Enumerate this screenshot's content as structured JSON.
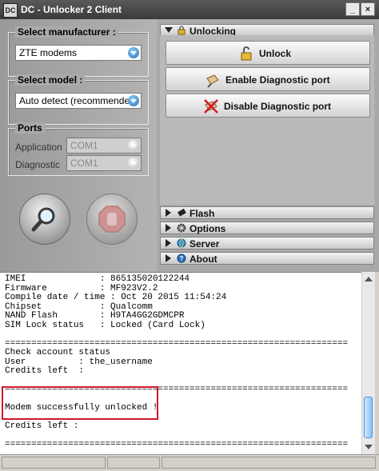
{
  "window": {
    "title": "DC - Unlocker 2 Client",
    "icon_text": "DC",
    "minimize": "_",
    "close": "×"
  },
  "manufacturer": {
    "label": "Select manufacturer :",
    "value": "ZTE modems"
  },
  "model": {
    "label": "Select model :",
    "value": "Auto detect (recommended)"
  },
  "ports": {
    "label": "Ports",
    "application_label": "Application",
    "application_value": "COM1",
    "diagnostic_label": "Diagnostic",
    "diagnostic_value": "COM1"
  },
  "sections": {
    "unlocking": "Unlocking",
    "flash": "Flash",
    "options": "Options",
    "server": "Server",
    "about": "About"
  },
  "buttons": {
    "unlock": "Unlock",
    "enable_diag": "Enable Diagnostic port",
    "disable_diag": "Disable Diagnostic port"
  },
  "icons": {
    "search": "magnifier-icon",
    "stop": "stop-hand-icon",
    "lock": "padlock-icon",
    "enable": "plug-icon",
    "disable": "crossed-plug-icon"
  },
  "colors": {
    "highlight": "#d0182a",
    "accent": "#1f6fb8"
  },
  "log": {
    "lines": [
      "IMEI              : 865135020122244",
      "Firmware          : MF923V2.2",
      "Compile date / time : Oct 20 2015 11:54:24",
      "Chipset           : Qualcomm",
      "NAND Flash        : H9TA4GG2GDMCPR",
      "SIM Lock status   : Locked (Card Lock)",
      "",
      "=================================================================",
      "Check account status",
      "User          : the_username",
      "Credits left  :",
      "",
      "=================================================================",
      "",
      "Modem successfully unlocked !",
      "",
      "Credits left :",
      "",
      "================================================================="
    ]
  }
}
